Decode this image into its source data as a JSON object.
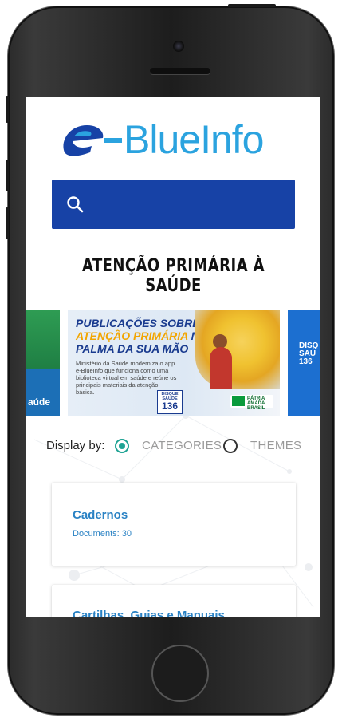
{
  "app": {
    "logo_text": "BlueInfo",
    "logo_letter": "e-",
    "brand_color": "#2ba3df",
    "brand_dark": "#1742a6"
  },
  "search": {
    "icon": "search-icon",
    "placeholder": ""
  },
  "page_title": "ATENÇÃO PRIMÁRIA À SAÚDE",
  "carousel": {
    "left_slide_label": "aúde",
    "right_slide_label": "DISQ SAÚ 136",
    "main": {
      "line1": "PUBLICAÇÕES SOBRE A",
      "line2_highlight": "ATENÇÃO PRIMÁRIA",
      "line2_rest": " NA",
      "line3": "PALMA DA SUA MÃO",
      "description": "Ministério da Saúde moderniza o app e-BlueInfo que funciona como uma biblioteca virtual em saúde e reúne os principais materiais da atenção básica.",
      "disque_label": "DISQUE SAÚDE",
      "disque_number": "136",
      "brasil_label": "PÁTRIA AMADA BRASIL"
    }
  },
  "display": {
    "label": "Display by:",
    "options": [
      {
        "label": "CATEGORIES",
        "selected": true
      },
      {
        "label": "THEMES",
        "selected": false
      }
    ]
  },
  "categories": [
    {
      "title": "Cadernos",
      "documents": "Documents: 30"
    },
    {
      "title": "Cartilhas, Guias e Manuais",
      "documents": ""
    }
  ]
}
